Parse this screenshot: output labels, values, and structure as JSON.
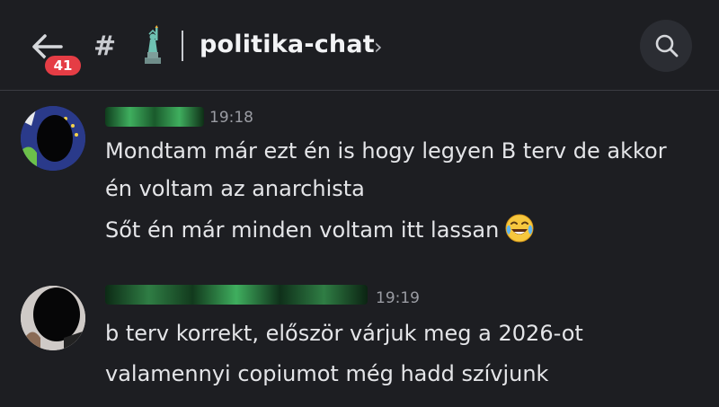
{
  "header": {
    "unread_count": "41",
    "channel_prefix": "#",
    "channel_name": "politika-chat",
    "chevron": "›",
    "icons": {
      "back": "back-arrow-icon",
      "search": "search-icon",
      "channel_emoji": "statue-of-liberty-icon"
    }
  },
  "messages": [
    {
      "author": "",
      "time": "19:18",
      "lines": [
        "Mondtam már ezt én is hogy legyen B terv de akkor",
        "én voltam az anarchista",
        "Sőt én már minden voltam itt lassan"
      ],
      "emoji": "face-with-tears-of-joy-icon"
    },
    {
      "author": "",
      "time": "19:19",
      "lines": [
        "b terv korrekt, először várjuk meg a 2026-ot",
        "valamennyi copiumot még hadd szívjunk"
      ]
    }
  ],
  "colors": {
    "background": "#1d1e22",
    "badge": "#e53d45",
    "username_green": "#3fae5e",
    "text": "#e4e5e8",
    "timestamp": "#9a9ca3"
  }
}
